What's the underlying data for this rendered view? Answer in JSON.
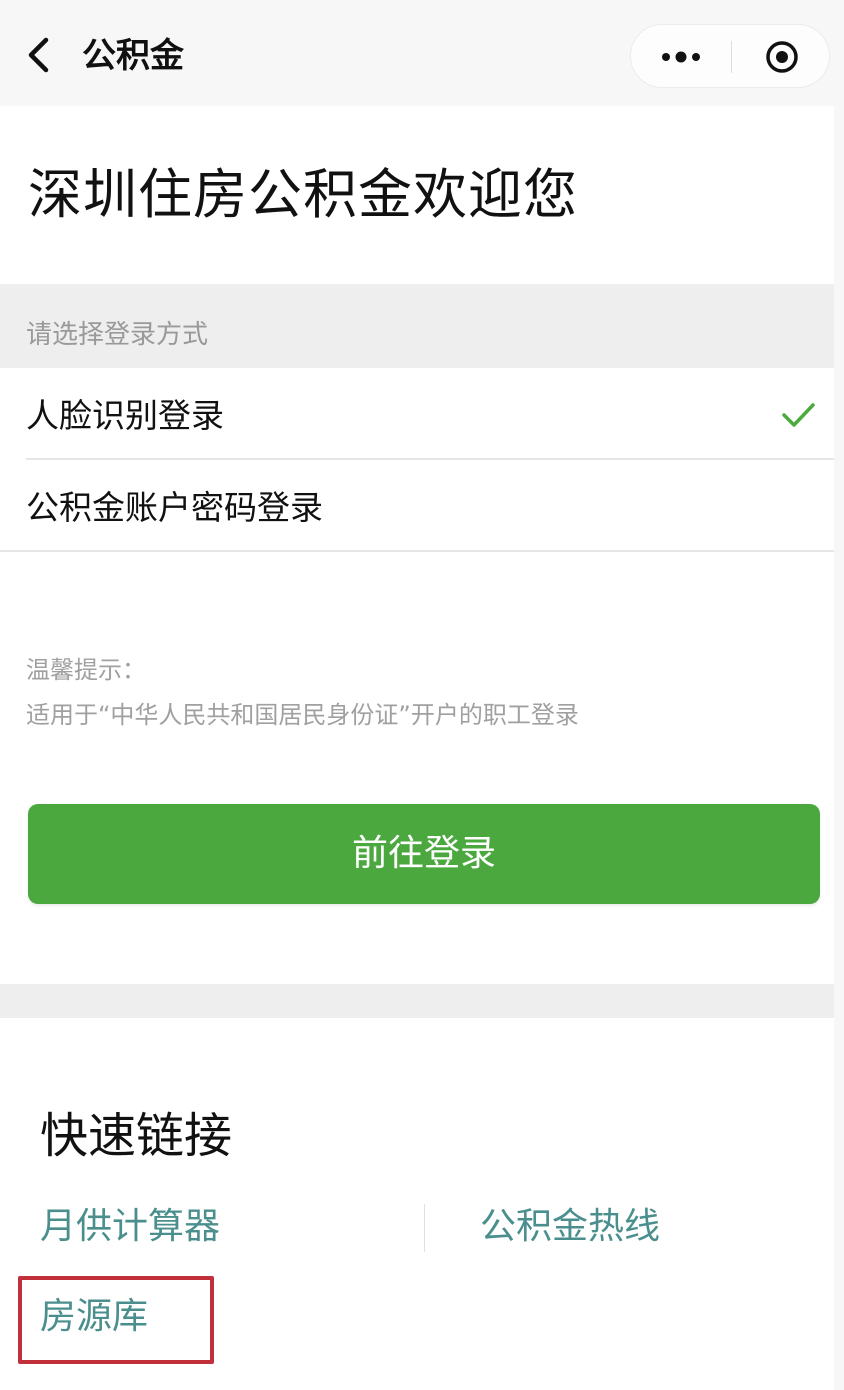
{
  "navbar": {
    "title": "公积金"
  },
  "welcome": {
    "heading": "深圳住房公积金欢迎您"
  },
  "login": {
    "section_label": "请选择登录方式",
    "options": [
      {
        "label": "人脸识别登录",
        "selected": true
      },
      {
        "label": "公积金账户密码登录",
        "selected": false
      }
    ],
    "tip_title": "温馨提示：",
    "tip_text": "适用于“中华人民共和国居民身份证”开户的职工登录",
    "button_label": "前往登录"
  },
  "quick_links": {
    "title": "快速链接",
    "items": [
      {
        "label": "月供计算器"
      },
      {
        "label": "公积金热线"
      },
      {
        "label": "房源库",
        "highlighted": true
      }
    ]
  },
  "colors": {
    "accent_green": "#4ba83f",
    "check_green": "#4caa3f",
    "link_teal": "#4a8f8d",
    "highlight_red": "#c0303a"
  },
  "icons": {
    "back": "chevron-left-icon",
    "more": "more-dots-icon",
    "close": "target-close-icon",
    "check": "checkmark-icon"
  }
}
